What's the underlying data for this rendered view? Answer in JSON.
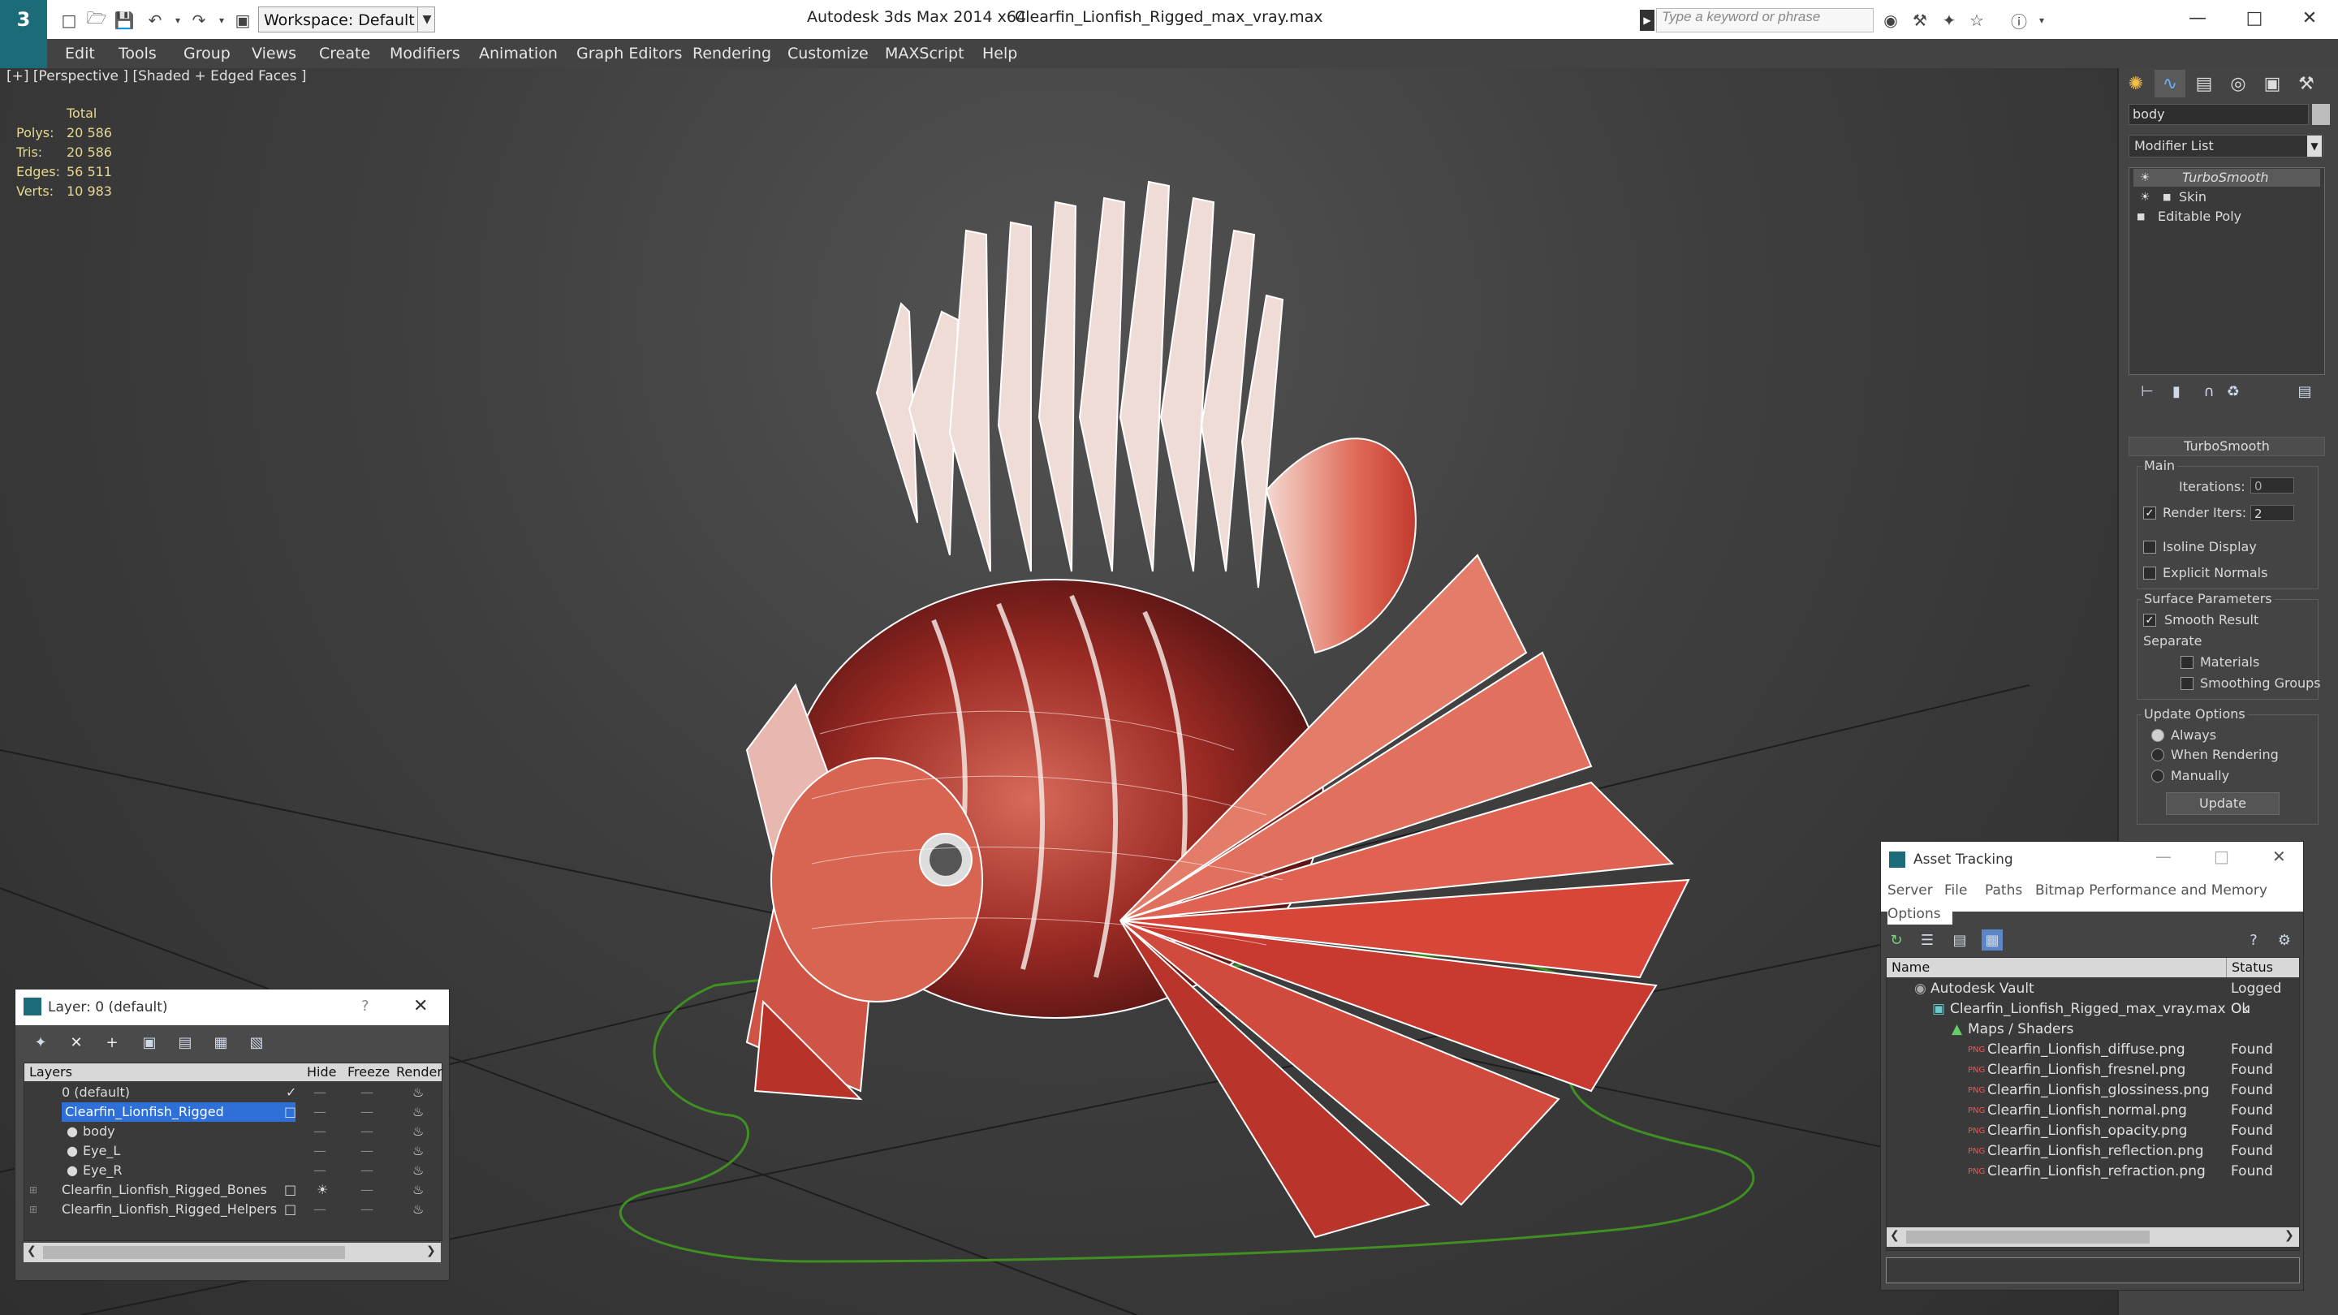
{
  "titlebar": {
    "app_title": "Autodesk 3ds Max  2014 x64",
    "file_name": "Clearfin_Lionfish_Rigged_max_vray.max",
    "workspace": "Workspace: Default",
    "search_placeholder": "Type a keyword or phrase"
  },
  "menu": [
    "Edit",
    "Tools",
    "Group",
    "Views",
    "Create",
    "Modifiers",
    "Animation",
    "Graph Editors",
    "Rendering",
    "Customize",
    "MAXScript",
    "Help"
  ],
  "viewport": {
    "label": "[+] [Perspective ] [Shaded + Edged Faces ]",
    "stats_header": "Total",
    "stats": [
      {
        "label": "Polys:",
        "value": "20 586"
      },
      {
        "label": "Tris:",
        "value": "20 586"
      },
      {
        "label": "Edges:",
        "value": "56 511"
      },
      {
        "label": "Verts:",
        "value": "10 983"
      }
    ]
  },
  "command_panel": {
    "object_name": "body",
    "modifier_list": "Modifier List",
    "stack": [
      "TurboSmooth",
      "Skin",
      "Editable Poly"
    ],
    "rollout_title": "TurboSmooth",
    "main_label": "Main",
    "iterations_label": "Iterations:",
    "iterations_value": "0",
    "render_iters_label": "Render Iters:",
    "render_iters_value": "2",
    "isoline_label": "Isoline Display",
    "explicit_normals_label": "Explicit Normals",
    "surface_params_label": "Surface Parameters",
    "smooth_result_label": "Smooth Result",
    "separate_label": "Separate",
    "materials_label": "Materials",
    "smoothing_groups_label": "Smoothing Groups",
    "update_options_label": "Update Options",
    "always_label": "Always",
    "when_rendering_label": "When Rendering",
    "manually_label": "Manually",
    "update_button": "Update"
  },
  "layer_window": {
    "title": "Layer: 0 (default)",
    "help": "?",
    "columns": [
      "Layers",
      "Hide",
      "Freeze",
      "Render"
    ],
    "rows": [
      {
        "name": "0 (default)",
        "indent": 0
      },
      {
        "name": "Clearfin_Lionfish_Rigged",
        "indent": 0
      },
      {
        "name": "body",
        "indent": 1
      },
      {
        "name": "Eye_L",
        "indent": 1
      },
      {
        "name": "Eye_R",
        "indent": 1
      },
      {
        "name": "Clearfin_Lionfish_Rigged_Bones",
        "indent": 0
      },
      {
        "name": "Clearfin_Lionfish_Rigged_Helpers",
        "indent": 0
      }
    ]
  },
  "asset_window": {
    "title": "Asset Tracking",
    "menu": [
      "Server",
      "File",
      "Paths",
      "Bitmap Performance and Memory",
      "Options"
    ],
    "columns": [
      "Name",
      "Status"
    ],
    "rows": [
      {
        "name": "Autodesk Vault",
        "status": "Logged Ou"
      },
      {
        "name": "Clearfin_Lionfish_Rigged_max_vray.max",
        "status": "Ok"
      },
      {
        "name": "Maps / Shaders",
        "status": ""
      },
      {
        "name": "Clearfin_Lionfish_diffuse.png",
        "status": "Found"
      },
      {
        "name": "Clearfin_Lionfish_fresnel.png",
        "status": "Found"
      },
      {
        "name": "Clearfin_Lionfish_glossiness.png",
        "status": "Found"
      },
      {
        "name": "Clearfin_Lionfish_normal.png",
        "status": "Found"
      },
      {
        "name": "Clearfin_Lionfish_opacity.png",
        "status": "Found"
      },
      {
        "name": "Clearfin_Lionfish_reflection.png",
        "status": "Found"
      },
      {
        "name": "Clearfin_Lionfish_refraction.png",
        "status": "Found"
      }
    ]
  },
  "icons": {
    "app_logo": "3ds-max-logo-icon",
    "png_badge": "PNG"
  }
}
